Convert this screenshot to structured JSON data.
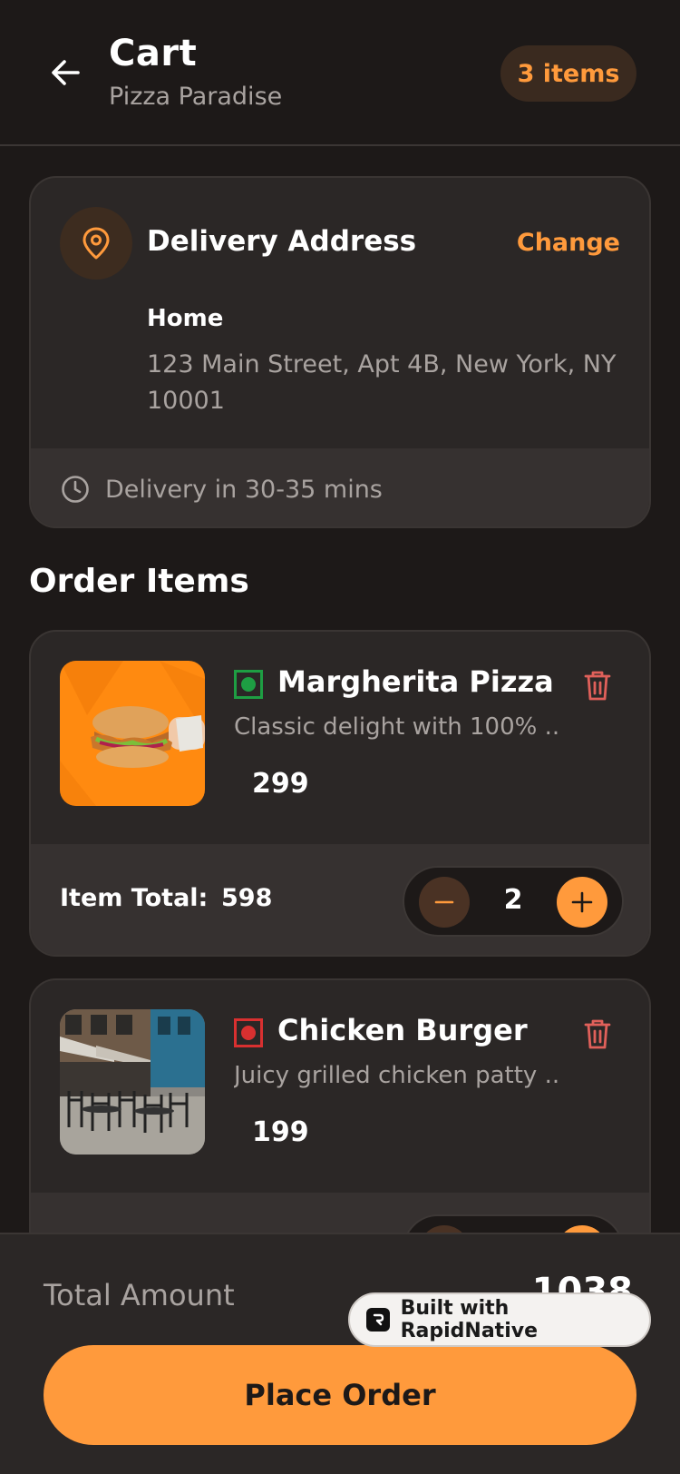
{
  "header": {
    "title": "Cart",
    "subtitle": "Pizza Paradise",
    "items_badge": "3 items"
  },
  "address": {
    "heading": "Delivery Address",
    "change_label": "Change",
    "label": "Home",
    "text": "123 Main Street, Apt 4B, New York, NY 10001",
    "delivery_time": "Delivery in 30-35 mins"
  },
  "order_items_title": "Order Items",
  "items": [
    {
      "name": "Margherita Pizza",
      "description": "Classic delight with 100% ...",
      "price": "299",
      "diet": "veg",
      "total_label": "Item Total:",
      "total_value": "598",
      "quantity": "2"
    },
    {
      "name": "Chicken Burger",
      "description": "Juicy grilled chicken patty ...",
      "price": "199",
      "diet": "non-veg"
    }
  ],
  "summary": {
    "total_label": "Total Amount",
    "total_value": "1038",
    "place_order_label": "Place Order"
  },
  "badge": {
    "text": "Built with RapidNative"
  },
  "colors": {
    "accent": "#ff9a3c",
    "background": "#1d1918",
    "card": "#2b2726",
    "veg": "#1e9e43",
    "non_veg": "#d93030",
    "delete": "#e0605a"
  },
  "icons": [
    "back-arrow-icon",
    "map-pin-icon",
    "clock-icon",
    "trash-icon",
    "minus-icon",
    "plus-icon",
    "rapidnative-logo-icon"
  ]
}
